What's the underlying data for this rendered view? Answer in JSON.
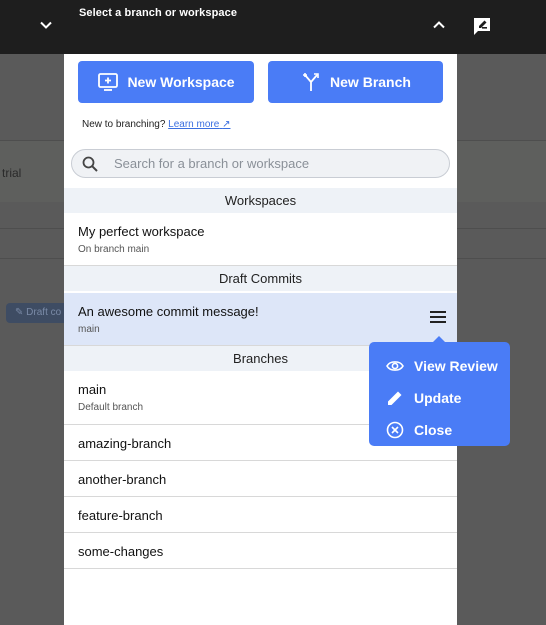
{
  "header": {
    "title": "Select a branch or workspace"
  },
  "background": {
    "trial_text": "trial",
    "pill_text": "Draft co"
  },
  "actions": {
    "new_workspace": "New Workspace",
    "new_branch": "New Branch"
  },
  "help": {
    "text": "New to branching?",
    "link": "Learn more"
  },
  "search": {
    "placeholder": "Search for a branch or workspace",
    "value": ""
  },
  "workspaces": {
    "heading": "Workspaces",
    "items": [
      {
        "name": "My perfect workspace",
        "sub": "On branch main"
      }
    ]
  },
  "draft_commits": {
    "heading": "Draft Commits",
    "items": [
      {
        "name": "An awesome commit message!",
        "sub": "main"
      }
    ]
  },
  "branches": {
    "heading": "Branches",
    "items": [
      {
        "name": "main",
        "sub": "Default branch"
      },
      {
        "name": "amazing-branch"
      },
      {
        "name": "another-branch"
      },
      {
        "name": "feature-branch"
      },
      {
        "name": "some-changes"
      }
    ]
  },
  "context_menu": {
    "items": [
      "View Review",
      "Update",
      "Close"
    ]
  },
  "colors": {
    "accent": "#4a7cf6",
    "section_bg": "#eef2f7",
    "selected_bg": "#dde6f8",
    "topbar": "#1e1e1e"
  },
  "icons": [
    "chevron-down-icon",
    "chevron-up-icon",
    "compose-icon",
    "workspace-add-icon",
    "branch-icon",
    "arrow-up-right-icon",
    "search-icon",
    "hamburger-icon",
    "eye-icon",
    "pencil-icon",
    "close-circle-icon"
  ]
}
